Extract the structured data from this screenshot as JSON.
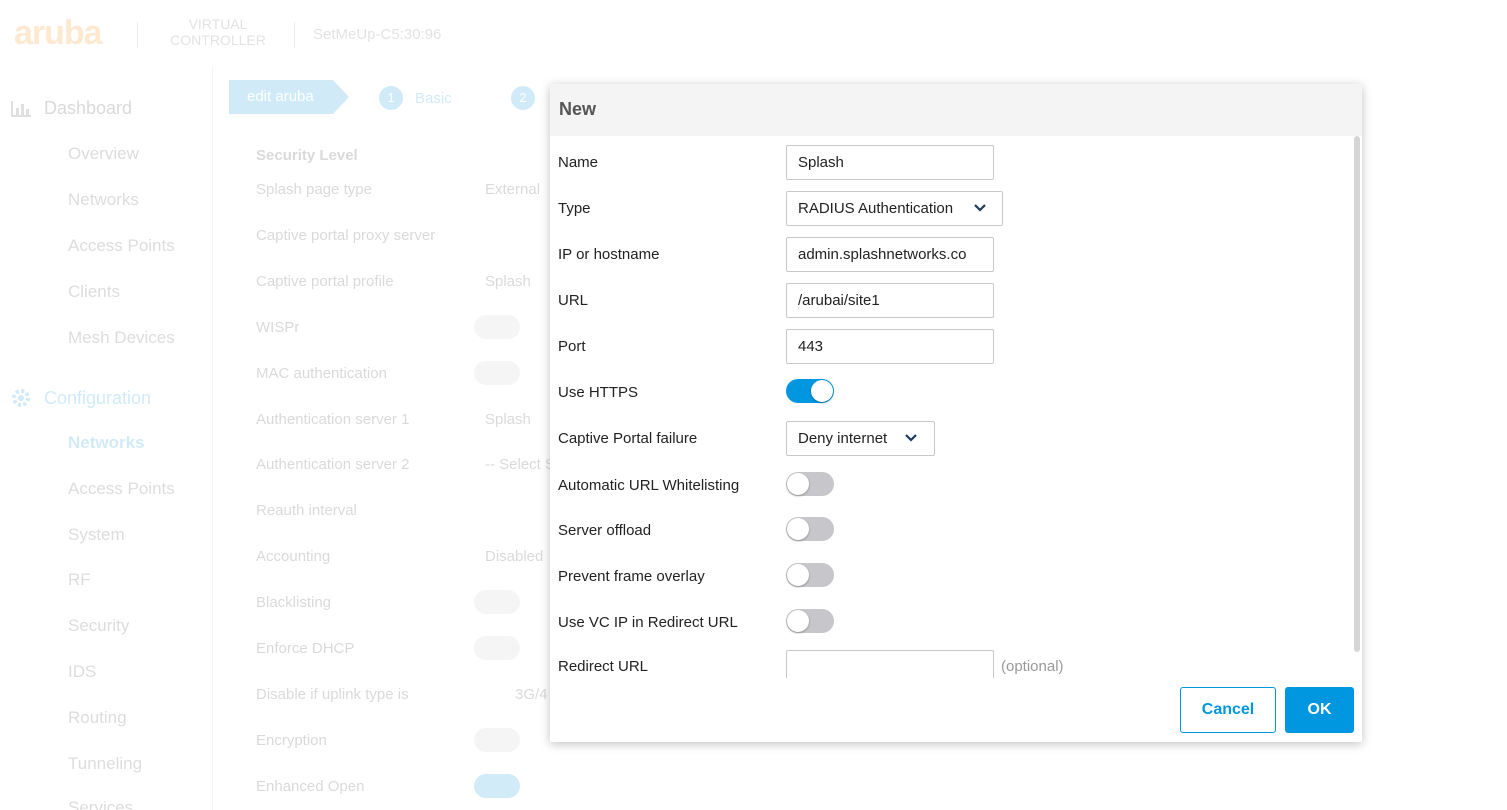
{
  "app": {
    "logo": "aruba",
    "product": "VIRTUAL CONTROLLER",
    "device": "SetMeUp-C5:30:96"
  },
  "sidebar": {
    "dashboard": {
      "label": "Dashboard",
      "items": [
        "Overview",
        "Networks",
        "Access Points",
        "Clients",
        "Mesh Devices"
      ]
    },
    "configuration": {
      "label": "Configuration",
      "items": [
        "Networks",
        "Access Points",
        "System",
        "RF",
        "Security",
        "IDS",
        "Routing",
        "Tunneling",
        "Services"
      ],
      "active": "Networks"
    }
  },
  "wizard": {
    "edit_label": "edit aruba",
    "steps": [
      {
        "num": "1",
        "label": "Basic"
      },
      {
        "num": "2",
        "label": ""
      }
    ]
  },
  "background_form": {
    "section_title": "Security Level",
    "rows": [
      {
        "label": "Splash page type",
        "value": "External"
      },
      {
        "label": "Captive portal proxy server",
        "value": ""
      },
      {
        "label": "Captive portal profile",
        "value": "Splash"
      },
      {
        "label": "WISPr",
        "value": ""
      },
      {
        "label": "MAC authentication",
        "value": ""
      },
      {
        "label": "Authentication server 1",
        "value": "Splash"
      },
      {
        "label": "Authentication server 2",
        "value": "-- Select S"
      },
      {
        "label": "Reauth interval",
        "value": ""
      },
      {
        "label": "Accounting",
        "value": "Disabled"
      },
      {
        "label": "Blacklisting",
        "value": ""
      },
      {
        "label": "Enforce DHCP",
        "value": ""
      },
      {
        "label": "Disable if uplink type is",
        "value": "3G/4"
      },
      {
        "label": "Encryption",
        "value": ""
      },
      {
        "label": "Enhanced Open",
        "value": ""
      }
    ]
  },
  "modal": {
    "title": "New",
    "fields": {
      "name": {
        "label": "Name",
        "value": "Splash"
      },
      "type": {
        "label": "Type",
        "value": "RADIUS Authentication"
      },
      "ip": {
        "label": "IP or hostname",
        "value": "admin.splashnetworks.co"
      },
      "url": {
        "label": "URL",
        "value": "/arubai/site1"
      },
      "port": {
        "label": "Port",
        "value": "443"
      },
      "https": {
        "label": "Use HTTPS",
        "on": true
      },
      "cp_failure": {
        "label": "Captive Portal failure",
        "value": "Deny internet"
      },
      "auto_whitelist": {
        "label": "Automatic URL Whitelisting",
        "on": false
      },
      "server_offload": {
        "label": "Server offload",
        "on": false
      },
      "frame_overlay": {
        "label": "Prevent frame overlay",
        "on": false
      },
      "vc_ip": {
        "label": "Use VC IP in Redirect URL",
        "on": false
      },
      "redirect": {
        "label": "Redirect URL",
        "value": "",
        "hint": "(optional)"
      }
    },
    "buttons": {
      "cancel": "Cancel",
      "ok": "OK"
    }
  },
  "colors": {
    "accent": "#0096e0",
    "brand": "#ff8300"
  }
}
